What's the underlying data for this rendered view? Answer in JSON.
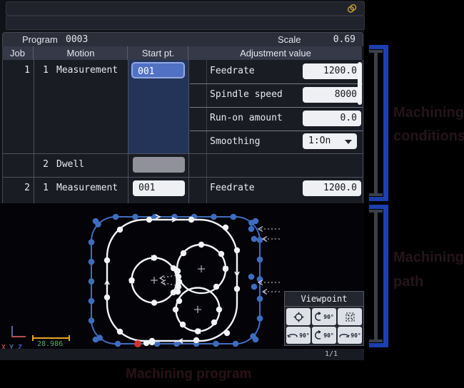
{
  "program_bar": {
    "program_label": "Program",
    "program_value": "0003",
    "scale_label": "Scale",
    "scale_value": "0.69"
  },
  "table": {
    "headers": {
      "job": "Job",
      "motion": "Motion",
      "start": "Start pt.",
      "adjustment": "Adjustment value"
    },
    "job1": {
      "job_no": "1",
      "motion1_no": "1",
      "motion1_name": "Measurement",
      "motion1_start": "001",
      "motion2_no": "2",
      "motion2_name": "Dwell",
      "adjustments": [
        {
          "label": "Feedrate",
          "value": "1200.0",
          "type": "input"
        },
        {
          "label": "Spindle speed",
          "value": "8000",
          "type": "input"
        },
        {
          "label": "Run-on amount",
          "value": "0.0",
          "type": "input"
        },
        {
          "label": "Smoothing",
          "value": "1:On",
          "type": "dropdown"
        }
      ]
    },
    "job2": {
      "job_no": "2",
      "motion_no": "1",
      "motion_name": "Measurement",
      "start": "001",
      "adjustment_label": "Feedrate",
      "adjustment_value": "1200.0"
    }
  },
  "graphics": {
    "ruler_value": "28.986",
    "axis_x": "X",
    "axis_y": "Y",
    "axis_z": "Z",
    "page_indicator": "1/1",
    "viewpoint": {
      "title": "Viewpoint",
      "rotate_label": "90°"
    },
    "colors": {
      "route_blue": "#3f6dbe",
      "contour_white": "#f2f4f8",
      "start_red": "#d5342c",
      "ruler_orange": "#e2a32c",
      "value_green": "#4fae6a"
    }
  },
  "annotations": {
    "top_bracket_line1": "Machining",
    "top_bracket_line2": "conditions",
    "bottom_bracket_line1": "Machining",
    "bottom_bracket_line2": "path",
    "caption": "Machining program",
    "bracket_color": "#1c3fae"
  }
}
